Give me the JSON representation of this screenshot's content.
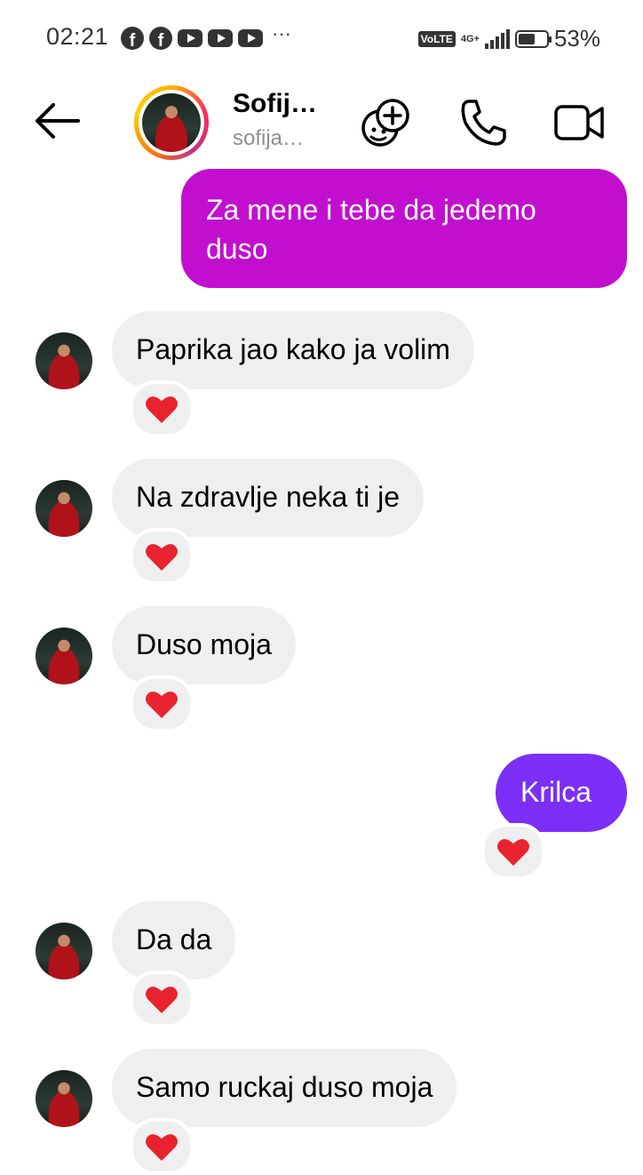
{
  "status_bar": {
    "time": "02:21",
    "overflow": "···",
    "volte": "VoLTE",
    "network": "4G+",
    "battery": "53%"
  },
  "header": {
    "name": "Sofij…",
    "username": "sofija…"
  },
  "messages": [
    {
      "text": "Za mene i tebe  da jedemo duso",
      "direction": "out",
      "color": "#c20fcf"
    },
    {
      "text": "Paprika jao kako ja volim",
      "direction": "in",
      "reaction": "heart"
    },
    {
      "text": "Na zdravlje neka ti je",
      "direction": "in",
      "reaction": "heart"
    },
    {
      "text": "Duso moja",
      "direction": "in",
      "reaction": "heart"
    },
    {
      "text": "Krilca",
      "direction": "out",
      "color": "#7b2ff7",
      "reaction": "heart"
    },
    {
      "text": "Da da",
      "direction": "in",
      "reaction": "heart"
    },
    {
      "text": "Samo ruckaj duso moja",
      "direction": "in",
      "reaction": "heart"
    }
  ],
  "colors": {
    "incoming_bubble": "#efefef",
    "reaction_heart": "#e8232f"
  }
}
